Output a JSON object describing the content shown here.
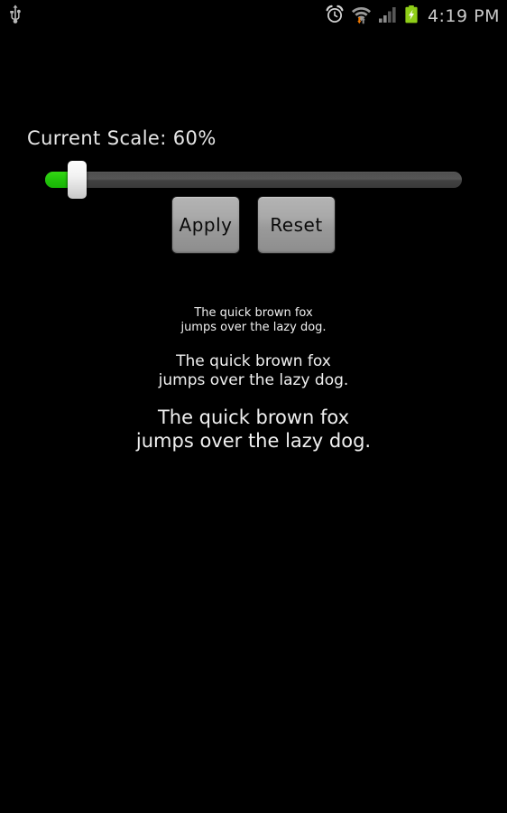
{
  "status_bar": {
    "left_icons": [
      {
        "name": "usb-icon",
        "label": "USB connected"
      }
    ],
    "right_icons": [
      {
        "name": "alarm-clock-icon",
        "label": "Alarm set"
      },
      {
        "name": "wifi-icon",
        "label": "Wi-Fi connected, data transfer"
      },
      {
        "name": "cellular-signal-icon",
        "label": "Cellular signal"
      },
      {
        "name": "battery-charging-icon",
        "label": "Battery charging"
      }
    ],
    "clock": "4:19 PM",
    "colors": {
      "background": "#000000",
      "icon": "#c9c9c9",
      "clock_text": "#c9c9c9",
      "battery_green": "#8fce18",
      "wifi_down_arrow": "#ee7700"
    }
  },
  "main": {
    "scale_label": "Current Scale: 60%",
    "slider": {
      "name": "scale-slider",
      "value": 60,
      "min": 0,
      "max": 100,
      "fill_percent": 7.8,
      "colors": {
        "fill": "#22c40a",
        "track": "#4e4e4e",
        "thumb": "#f2f2f2"
      }
    },
    "buttons": {
      "apply_label": "Apply",
      "reset_label": "Reset",
      "colors": {
        "face": "#a9a9a9",
        "text": "#0a0a0a",
        "border": "#1d1d1d"
      }
    },
    "samples": [
      {
        "name": "sample-text-small",
        "line1": "The quick brown fox",
        "line2": "jumps over the lazy dog."
      },
      {
        "name": "sample-text-medium",
        "line1": "The quick brown fox",
        "line2": "jumps over the lazy dog."
      },
      {
        "name": "sample-text-large",
        "line1": "The quick brown fox",
        "line2": "jumps over the lazy dog."
      }
    ]
  }
}
